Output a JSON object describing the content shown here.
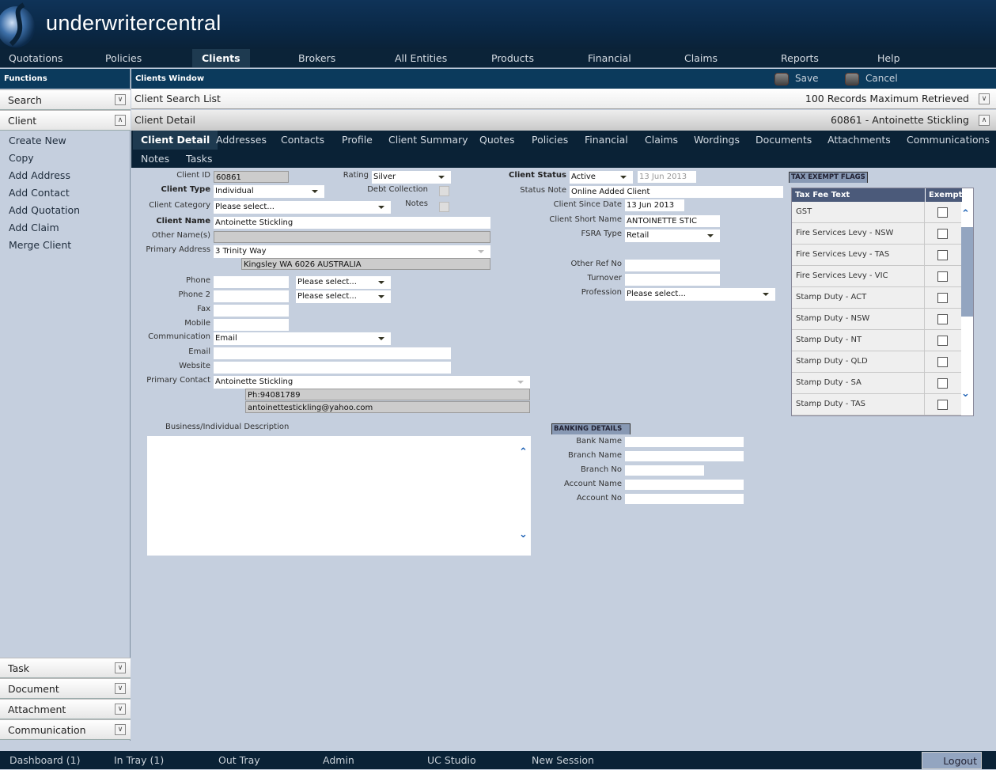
{
  "app": {
    "brand": "underwritercentral"
  },
  "nav": [
    "Quotations",
    "Policies",
    "Clients",
    "Brokers",
    "All Entities",
    "Products",
    "Financial",
    "Claims",
    "Reports",
    "Help"
  ],
  "nav_active": "Clients",
  "functions_title": "Functions",
  "window_title": "Clients Window",
  "toolbar": {
    "save": "Save",
    "cancel": "Cancel"
  },
  "sidebar": {
    "search": "Search",
    "client": "Client",
    "client_functions": [
      "Create New",
      "Copy",
      "Add Address",
      "Add Contact",
      "Add Quotation",
      "Add Claim",
      "Merge Client"
    ],
    "bottom": [
      "Task",
      "Document",
      "Attachment",
      "Communication"
    ]
  },
  "panels": {
    "search_list": {
      "title": "Client Search List",
      "info": "100 Records Maximum Retrieved"
    },
    "detail": {
      "title": "Client Detail",
      "info": "60861 - Antoinette Stickling"
    }
  },
  "tabs": [
    "Client Detail",
    "Addresses",
    "Contacts",
    "Profile",
    "Client Summary",
    "Quotes",
    "Policies",
    "Financial",
    "Claims",
    "Wordings",
    "Documents",
    "Attachments",
    "Communications",
    "Notes",
    "Tasks"
  ],
  "tab_active": "Client Detail",
  "form": {
    "fields": [
      {
        "label": "Client ID",
        "value": "60861"
      },
      {
        "label": "Rating",
        "value": "Silver"
      },
      {
        "label": "Client Type",
        "value": "Individual"
      },
      {
        "label": "Client Category",
        "value": "Please select..."
      },
      {
        "label": "Client Name",
        "value": "Antoinette Stickling"
      },
      {
        "label": "Other Name(s)",
        "value": ""
      },
      {
        "label": "Primary Address",
        "value": "3 Trinity Way"
      },
      {
        "label": "",
        "value": "Kingsley WA 6026 AUSTRALIA"
      },
      {
        "label": "Phone",
        "value": ""
      },
      {
        "label": "",
        "value": "Please select..."
      },
      {
        "label": "Phone 2",
        "value": ""
      },
      {
        "label": "",
        "value": "Please select..."
      },
      {
        "label": "Fax",
        "value": ""
      },
      {
        "label": "Mobile",
        "value": ""
      },
      {
        "label": "Communication",
        "value": "Email"
      },
      {
        "label": "Email",
        "value": ""
      },
      {
        "label": "Website",
        "value": ""
      },
      {
        "label": "Primary Contact",
        "value": "Antoinette Stickling"
      },
      {
        "label": "",
        "value": "Ph:94081789"
      },
      {
        "label": "",
        "value": "antoinettestickling@yahoo.com"
      },
      {
        "label": "Client Status",
        "value": "Active"
      },
      {
        "label": "",
        "value": "13 Jun 2013"
      },
      {
        "label": "Status Note",
        "value": "Online Added Client"
      },
      {
        "label": "Client Since Date",
        "value": "13 Jun 2013"
      },
      {
        "label": "Client Short Name",
        "value": "ANTOINETTE STIC"
      },
      {
        "label": "FSRA Type",
        "value": "Retail"
      },
      {
        "label": "Other Ref No",
        "value": ""
      },
      {
        "label": "Turnover",
        "value": ""
      },
      {
        "label": "Profession",
        "value": "Please select..."
      }
    ],
    "checkboxes": [
      {
        "label": "Debt Collection",
        "checked": false
      },
      {
        "label": "Notes",
        "checked": false
      }
    ],
    "description_label": "Business/Individual Description",
    "banking": {
      "title": "BANKING DETAILS",
      "fields": [
        {
          "label": "Bank Name",
          "value": ""
        },
        {
          "label": "Branch Name",
          "value": ""
        },
        {
          "label": "Branch No",
          "value": ""
        },
        {
          "label": "Account Name",
          "value": ""
        },
        {
          "label": "Account No",
          "value": ""
        }
      ]
    },
    "tax": {
      "title": "TAX EXEMPT FLAGS",
      "col_text": "Tax Fee Text",
      "col_exempt": "Exempt",
      "rows": [
        {
          "text": "GST",
          "exempt": false
        },
        {
          "text": "Fire Services Levy - NSW",
          "exempt": false
        },
        {
          "text": "Fire Services Levy - TAS",
          "exempt": false
        },
        {
          "text": "Fire Services Levy - VIC",
          "exempt": false
        },
        {
          "text": "Stamp Duty - ACT",
          "exempt": false
        },
        {
          "text": "Stamp Duty - NSW",
          "exempt": false
        },
        {
          "text": "Stamp Duty - NT",
          "exempt": false
        },
        {
          "text": "Stamp Duty - QLD",
          "exempt": false
        },
        {
          "text": "Stamp Duty - SA",
          "exempt": false
        },
        {
          "text": "Stamp Duty - TAS",
          "exempt": false
        }
      ]
    }
  },
  "footer": [
    "Dashboard (1)",
    "In Tray (1)",
    "Out Tray",
    "Admin",
    "UC Studio",
    "New Session"
  ],
  "logout": "Logout",
  "colors": {
    "header": "#0a2846",
    "nav": "#0b2338",
    "bar": "#0b3a5c",
    "background": "#c5cfde",
    "table_header": "#4b5a7a"
  }
}
